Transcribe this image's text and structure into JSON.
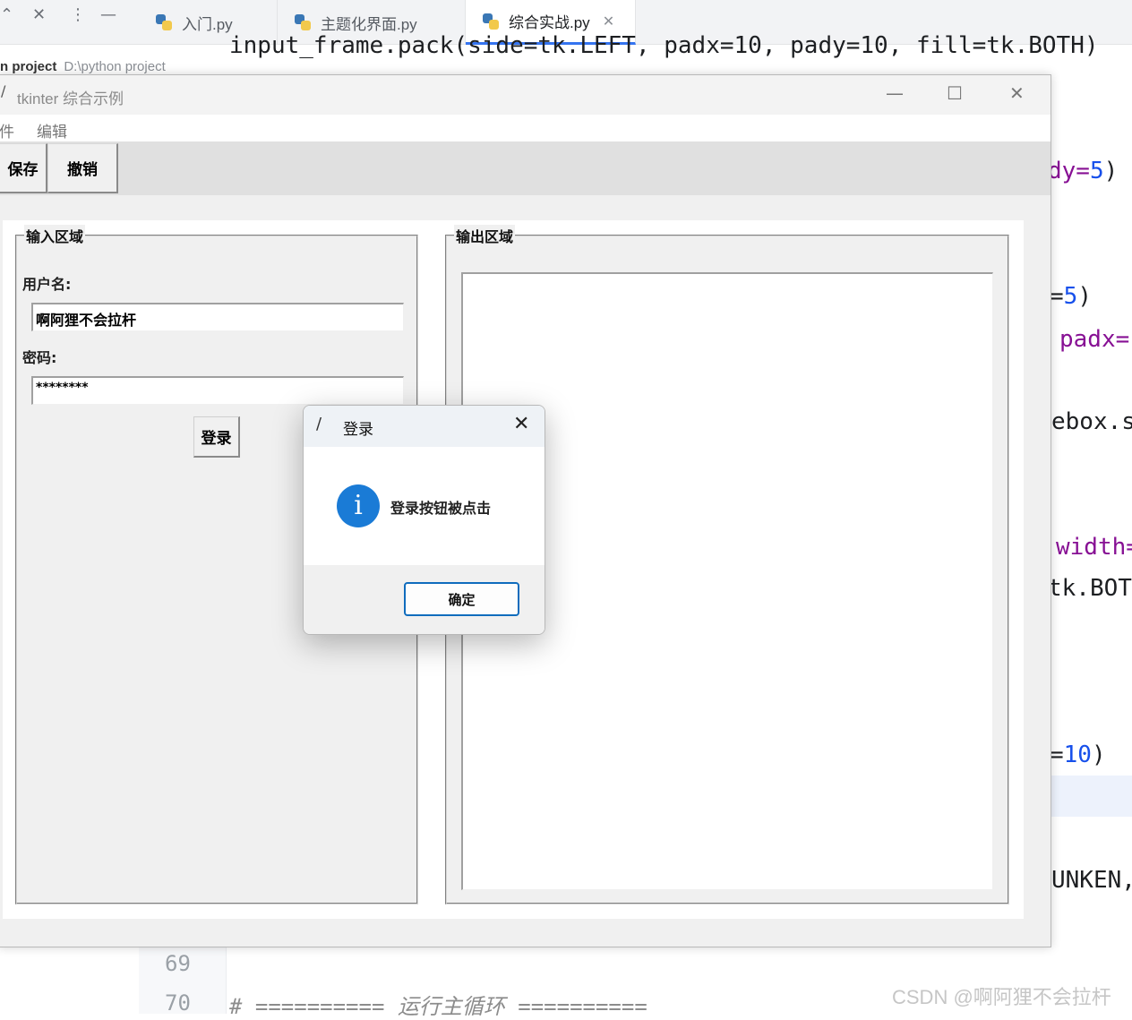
{
  "ide": {
    "tabs": [
      {
        "label": "入门.py",
        "active": false
      },
      {
        "label": "主题化界面.py",
        "active": false
      },
      {
        "label": "综合实战.py",
        "active": true
      }
    ],
    "project_label": "n project",
    "project_path": "D:\\python project",
    "code_top_line": "input_frame.pack(side=tk.LEFT, padx=10, pady=10, fill=tk.BOTH)",
    "code_fragments": {
      "pady5_a": "dy=",
      "pady5_a_num": "5",
      "pady5_a_close": ")",
      "eq5": "=",
      "eq5_num": "5",
      "eq5_close": ")",
      "padx": "padx=",
      "messagebox": "ebox.s",
      "width": "width=",
      "tkbot": "tk.BOT",
      "eq10": "=",
      "eq10_num": "10",
      "eq10_close": ")",
      "sunken": "UNKEN,"
    },
    "line_numbers": [
      "69",
      "70"
    ],
    "comment_line": "# ========== 运行主循环 ==========",
    "watermark": "CSDN @啊阿狸不会拉杆",
    "accent": "#3574f0"
  },
  "tk_window": {
    "title": "tkinter 综合示例",
    "menu": [
      "件",
      "编辑"
    ],
    "toolbar": [
      "保存",
      "撤销"
    ],
    "input_frame": {
      "legend": "输入区域",
      "username_label": "用户名:",
      "username_value": "啊阿狸不会拉杆",
      "password_label": "密码:",
      "password_value": "********",
      "login_button": "登录"
    },
    "output_frame": {
      "legend": "输出区域"
    }
  },
  "dialog": {
    "title": "登录",
    "message": "登录按钮被点击",
    "ok_button": "确定",
    "icon": "info-icon",
    "accent": "#1a7bd6"
  }
}
